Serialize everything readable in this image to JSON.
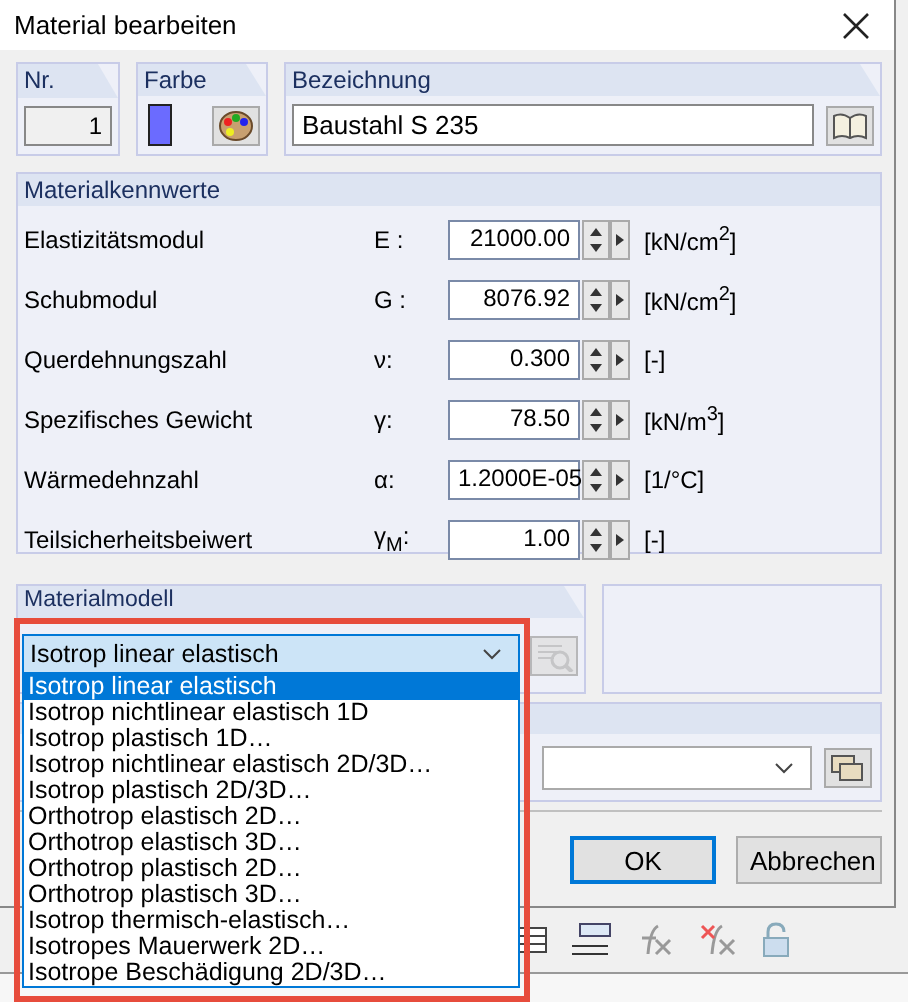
{
  "window": {
    "title": "Material bearbeiten"
  },
  "number": {
    "label": "Nr.",
    "value": "1"
  },
  "color_group": {
    "label": "Farbe",
    "color": "#6b6bff"
  },
  "name": {
    "label": "Bezeichnung",
    "value": "Baustahl S 235"
  },
  "properties": {
    "title": "Materialkennwerte",
    "rows": [
      {
        "label": "Elastizitätsmodul",
        "symbol": "E :",
        "value": "21000.00",
        "unit": "[kN/cm$^{2}$]"
      },
      {
        "label": "Schubmodul",
        "symbol": "G :",
        "value": "8076.92",
        "unit": "[kN/cm$^{2}$]"
      },
      {
        "label": "Querdehnungszahl",
        "symbol": "ν:",
        "value": "0.300",
        "unit": "[-]"
      },
      {
        "label": "Spezifisches Gewicht",
        "symbol": "γ:",
        "value": "78.50",
        "unit": "[kN/m$^{3}$]"
      },
      {
        "label": "Wärmedehnzahl",
        "symbol": "α:",
        "value": "1.2000E-05",
        "unit": "[1/°C]"
      },
      {
        "label": "Teilsicherheitsbeiwert",
        "symbol": "γ$_{M}$:",
        "value": "1.00",
        "unit": "[-]"
      }
    ]
  },
  "material_model": {
    "title": "Materialmodell",
    "value": "Isotrop linear elastisch",
    "options": [
      {
        "label": "Isotrop linear elastisch",
        "selected": true
      },
      {
        "label": "Isotrop nichtlinear elastisch 1D",
        "selected": false
      },
      {
        "label": "Isotrop plastisch 1D…",
        "selected": false
      },
      {
        "label": "Isotrop nichtlinear elastisch 2D/3D…",
        "selected": false
      },
      {
        "label": "Isotrop plastisch 2D/3D…",
        "selected": false
      },
      {
        "label": "Orthotrop elastisch 2D…",
        "selected": false
      },
      {
        "label": "Orthotrop elastisch 3D…",
        "selected": false
      },
      {
        "label": "Orthotrop plastisch 2D…",
        "selected": false
      },
      {
        "label": "Orthotrop plastisch 3D…",
        "selected": false
      },
      {
        "label": "Isotrop thermisch-elastisch…",
        "selected": false
      },
      {
        "label": "Isotropes Mauerwerk 2D…",
        "selected": false
      },
      {
        "label": "Isotrope Beschädigung 2D/3D…",
        "selected": false
      }
    ]
  },
  "buttons": [
    {
      "label": "OK",
      "kind": "default"
    },
    {
      "label": "Abbrechen",
      "kind": "normal"
    }
  ]
}
